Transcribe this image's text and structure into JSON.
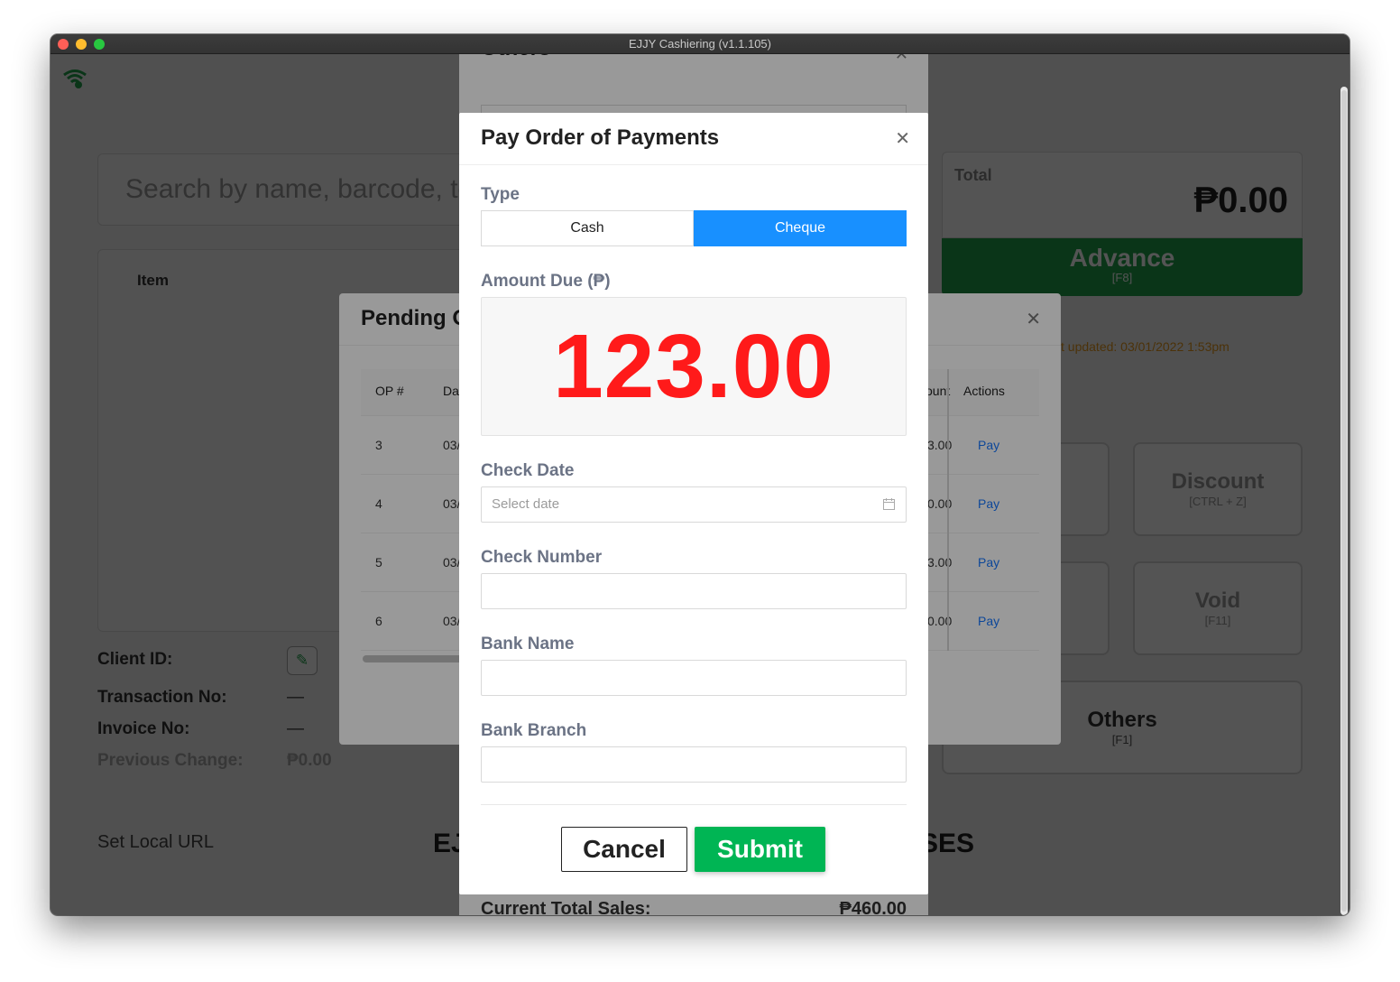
{
  "window": {
    "title": "EJJY Cashiering (v1.1.105)"
  },
  "background": {
    "search_placeholder": "Search by name, barcode, te",
    "item_column": "Item",
    "total_label": "Total",
    "total_value": "₱0.00",
    "advance_label": "Advance",
    "advance_shortcut": "[F8]",
    "last_updated": "t updated: 03/01/2022 1:53pm",
    "discount_label": "Discount",
    "discount_shortcut": "[CTRL + Z]",
    "void_label": "Void",
    "void_shortcut": "[F11]",
    "others_label": "Others",
    "others_shortcut": "[F1]",
    "client_id_label": "Client ID:",
    "transaction_no_label": "Transaction No:",
    "transaction_no_value": "—",
    "invoice_no_label": "Invoice No:",
    "invoice_no_value": "—",
    "previous_change_label": "Previous Change:",
    "previous_change_value": "₱0.00",
    "set_local_url": "Set Local URL",
    "footer_left": "EJ",
    "footer_right": "SES"
  },
  "others_modal": {
    "title": "Others",
    "current_total_sales_label": "Current Total Sales:",
    "current_total_sales_value": "₱460.00"
  },
  "pending_modal": {
    "title": "Pending O",
    "columns": {
      "op": "OP #",
      "date": "Da",
      "amount": "ount",
      "actions": "Actions"
    },
    "rows": [
      {
        "op": "3",
        "date": "03/",
        "amount": "3.00",
        "action": "Pay"
      },
      {
        "op": "4",
        "date": "03/",
        "amount": "0.00",
        "action": "Pay"
      },
      {
        "op": "5",
        "date": "03/",
        "amount": "3.00",
        "action": "Pay"
      },
      {
        "op": "6",
        "date": "03/",
        "amount": "0.00",
        "action": "Pay"
      }
    ]
  },
  "modal": {
    "title": "Pay Order of Payments",
    "type_label": "Type",
    "type_options": [
      "Cash",
      "Cheque"
    ],
    "type_selected": "Cheque",
    "amount_due_label": "Amount Due (₱)",
    "amount_due_value": "123.00",
    "check_date_label": "Check Date",
    "check_date_placeholder": "Select date",
    "check_number_label": "Check Number",
    "check_number_value": "",
    "bank_name_label": "Bank Name",
    "bank_name_value": "",
    "bank_branch_label": "Bank Branch",
    "bank_branch_value": "",
    "cancel_label": "Cancel",
    "submit_label": "Submit"
  },
  "colors": {
    "accent": "#1890ff",
    "amount": "#ff1a1a",
    "submit": "#00b554",
    "advance": "#1fa24a",
    "label": "#6b7385"
  },
  "icons": [
    "close-icon",
    "calendar-icon",
    "wifi-icon",
    "edit-icon"
  ]
}
